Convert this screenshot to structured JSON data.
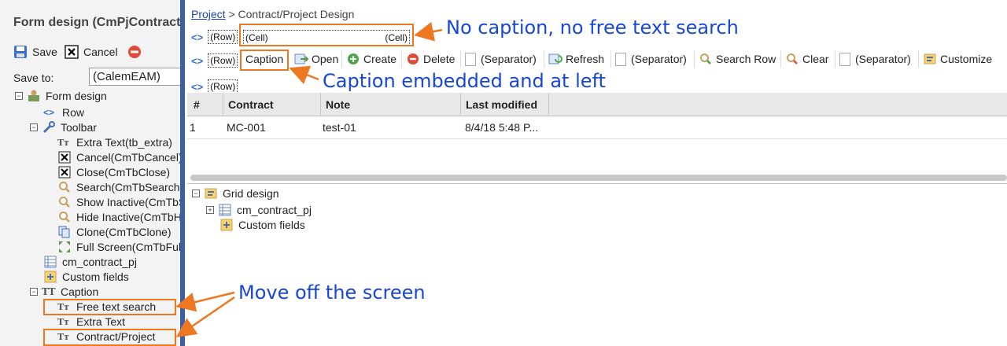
{
  "left": {
    "title": "Form design (CmPjContractWorkFlow)",
    "toolbar": {
      "save": "Save",
      "cancel": "Cancel"
    },
    "save_to": {
      "label": "Save to:",
      "value": "(CalemEAM)"
    },
    "tree": {
      "form_design": "Form design",
      "row": "Row",
      "toolbar": "Toolbar",
      "toolbar_items": [
        "Extra Text(tb_extra)",
        "Cancel(CmTbCancel)",
        "Close(CmTbClose)",
        "Search(CmTbSearch)",
        "Show Inactive(CmTbShowInactive)",
        "Hide Inactive(CmTbHideInactive)",
        "Clone(CmTbClone)",
        "Full Screen(CmTbFullScreen)"
      ],
      "cm_contract_pj": "cm_contract_pj",
      "custom_fields": "Custom fields",
      "caption": "Caption",
      "caption_items": [
        "Free text search",
        "Extra Text",
        "Contract/Project"
      ]
    }
  },
  "breadcrumb": {
    "link": "Project",
    "rest": " > Contract/Project Design"
  },
  "rows": {
    "row1": {
      "row": "(Row)",
      "cell_left": "(Cell)",
      "cell_right": "(Cell)"
    },
    "row2": {
      "row": "(Row)",
      "caption": "Caption"
    },
    "row3": {
      "row": "(Row)"
    }
  },
  "toolbar": {
    "open": "Open",
    "create": "Create",
    "delete": "Delete",
    "sep": "(Separator)",
    "refresh": "Refresh",
    "search_row": "Search Row",
    "clear": "Clear",
    "customize": "Customize"
  },
  "grid": {
    "columns": [
      "#",
      "Contract",
      "Note",
      "Last modified"
    ],
    "rows": [
      [
        "1",
        "MC-001",
        "test-01",
        "8/4/18 5:48 P..."
      ]
    ]
  },
  "bottom_tree": {
    "grid_design": "Grid design",
    "cm_contract_pj": "cm_contract_pj",
    "custom_fields": "Custom fields"
  },
  "annotations": {
    "no_caption": "No caption, no free text search",
    "embedded": "Caption embedded and at left",
    "move_off": "Move off the screen"
  },
  "colors": {
    "accent": "#ee7722",
    "annotation_text": "#1846d6",
    "divider": "#3a5fa8"
  }
}
